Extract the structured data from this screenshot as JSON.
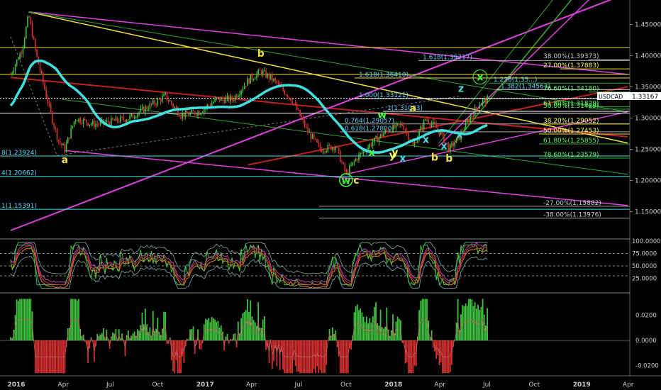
{
  "chart_data": [
    {
      "type": "candlestick",
      "symbol": "USDCAD",
      "current_price": "1.33167",
      "y_ticks": [
        "1.45000",
        "1.40000",
        "1.35000",
        "1.30000",
        "1.25000",
        "1.20000",
        "1.15000"
      ],
      "y_tick_values": [
        1.45,
        1.4,
        1.35,
        1.3,
        1.25,
        1.2,
        1.15
      ],
      "ylim": [
        1.12,
        1.48
      ],
      "x_ticks": [
        "2016",
        "Apr",
        "Jul",
        "Oct",
        "2017",
        "Apr",
        "Jul",
        "Oct",
        "2018",
        "Apr",
        "Jul",
        "Oct",
        "2019",
        "Apr"
      ],
      "x_tick_values": [
        0,
        91,
        182,
        274,
        366,
        456,
        547,
        639,
        731,
        821,
        912,
        1004,
        1096,
        1186
      ],
      "xlim": [
        0,
        1196
      ],
      "price_path": [
        [
          0,
          1.37
        ],
        [
          22,
          1.41
        ],
        [
          35,
          1.465
        ],
        [
          50,
          1.4
        ],
        [
          65,
          1.35
        ],
        [
          80,
          1.3
        ],
        [
          92,
          1.265
        ],
        [
          105,
          1.25
        ],
        [
          125,
          1.3
        ],
        [
          160,
          1.29
        ],
        [
          200,
          1.295
        ],
        [
          230,
          1.3
        ],
        [
          260,
          1.315
        ],
        [
          300,
          1.335
        ],
        [
          330,
          1.305
        ],
        [
          366,
          1.31
        ],
        [
          400,
          1.33
        ],
        [
          430,
          1.33
        ],
        [
          460,
          1.36
        ],
        [
          485,
          1.375
        ],
        [
          510,
          1.36
        ],
        [
          545,
          1.33
        ],
        [
          575,
          1.28
        ],
        [
          600,
          1.25
        ],
        [
          630,
          1.255
        ],
        [
          650,
          1.21
        ],
        [
          670,
          1.235
        ],
        [
          700,
          1.26
        ],
        [
          730,
          1.28
        ],
        [
          760,
          1.29
        ],
        [
          780,
          1.255
        ],
        [
          805,
          1.3
        ],
        [
          830,
          1.28
        ],
        [
          850,
          1.25
        ],
        [
          870,
          1.27
        ],
        [
          890,
          1.3
        ],
        [
          910,
          1.325
        ],
        [
          925,
          1.33
        ]
      ],
      "fib_levels": [
        {
          "label": "1.618(1.39217)",
          "color": "#5fd7ff"
        },
        {
          "label": "1.618(1.36410)",
          "color": "#5fd7ff"
        },
        {
          "label": "1.236(1.35...)",
          "color": "#5fd7ff"
        },
        {
          "label": "1.382(1.34563)",
          "color": "#5fd7ff"
        },
        {
          "label": "1.000(1.33121)",
          "color": "#5fd7ff"
        },
        {
          "label": "1(1.31083)",
          "color": "#5fd7ff"
        },
        {
          "label": "0.764(1.29057)",
          "color": "#5fd7ff"
        },
        {
          "label": "0.618(1.27800)",
          "color": "#5fd7ff"
        },
        {
          "label": "8(1.23924)",
          "color": "#5fd7ff"
        },
        {
          "label": "4(1.20662)",
          "color": "#5fd7ff"
        },
        {
          "label": "1(1.15391)",
          "color": "#5fd7ff"
        },
        {
          "label": "38.00%(1.39373)",
          "color": "#cccccc"
        },
        {
          "label": "27.00%(1.37883)",
          "color": "#ffff66"
        },
        {
          "label": "76.60%(1.34180)",
          "color": "#66ff66"
        },
        {
          "label": "61.80%(1.31829)",
          "color": "#66ff66"
        },
        {
          "label": "50.00%(1.31429)",
          "color": "#66ff66"
        },
        {
          "label": "38.20%(1.29052)",
          "color": "#ffff66"
        },
        {
          "label": "50.00%(1.27453)",
          "color": "#ffff66"
        },
        {
          "label": "61.80%(1.25855)",
          "color": "#66ff66"
        },
        {
          "label": "78.60%(1.23579)",
          "color": "#66ff66"
        },
        {
          "label": "-27.00%(1.15882)",
          "color": "#cccccc"
        },
        {
          "label": "-38.00%(1.13976)",
          "color": "#cccccc"
        }
      ],
      "wave_labels": [
        "a",
        "b",
        "c",
        "w",
        "x",
        "y",
        "b",
        "x",
        "w",
        "x",
        "y",
        "a",
        "b",
        "x",
        "x",
        "z",
        "x"
      ]
    },
    {
      "type": "line",
      "name": "oscillator",
      "y_ticks": [
        "100.0000",
        "75.0000",
        "50.0000",
        "25.0000"
      ],
      "ylim": [
        0,
        100
      ]
    },
    {
      "type": "bar",
      "name": "histogram",
      "y_ticks": [
        "0.0200",
        "0.0000",
        "-0.0200"
      ],
      "ylim": [
        -0.027,
        0.035
      ]
    }
  ],
  "colors": {
    "background": "#000000",
    "up": "#3fc33f",
    "down": "#d83030",
    "magenta": "#e040e0",
    "yellow": "#f0e040",
    "cyan": "#40e0e0",
    "red": "#c02020",
    "green": "#2ea82e"
  }
}
